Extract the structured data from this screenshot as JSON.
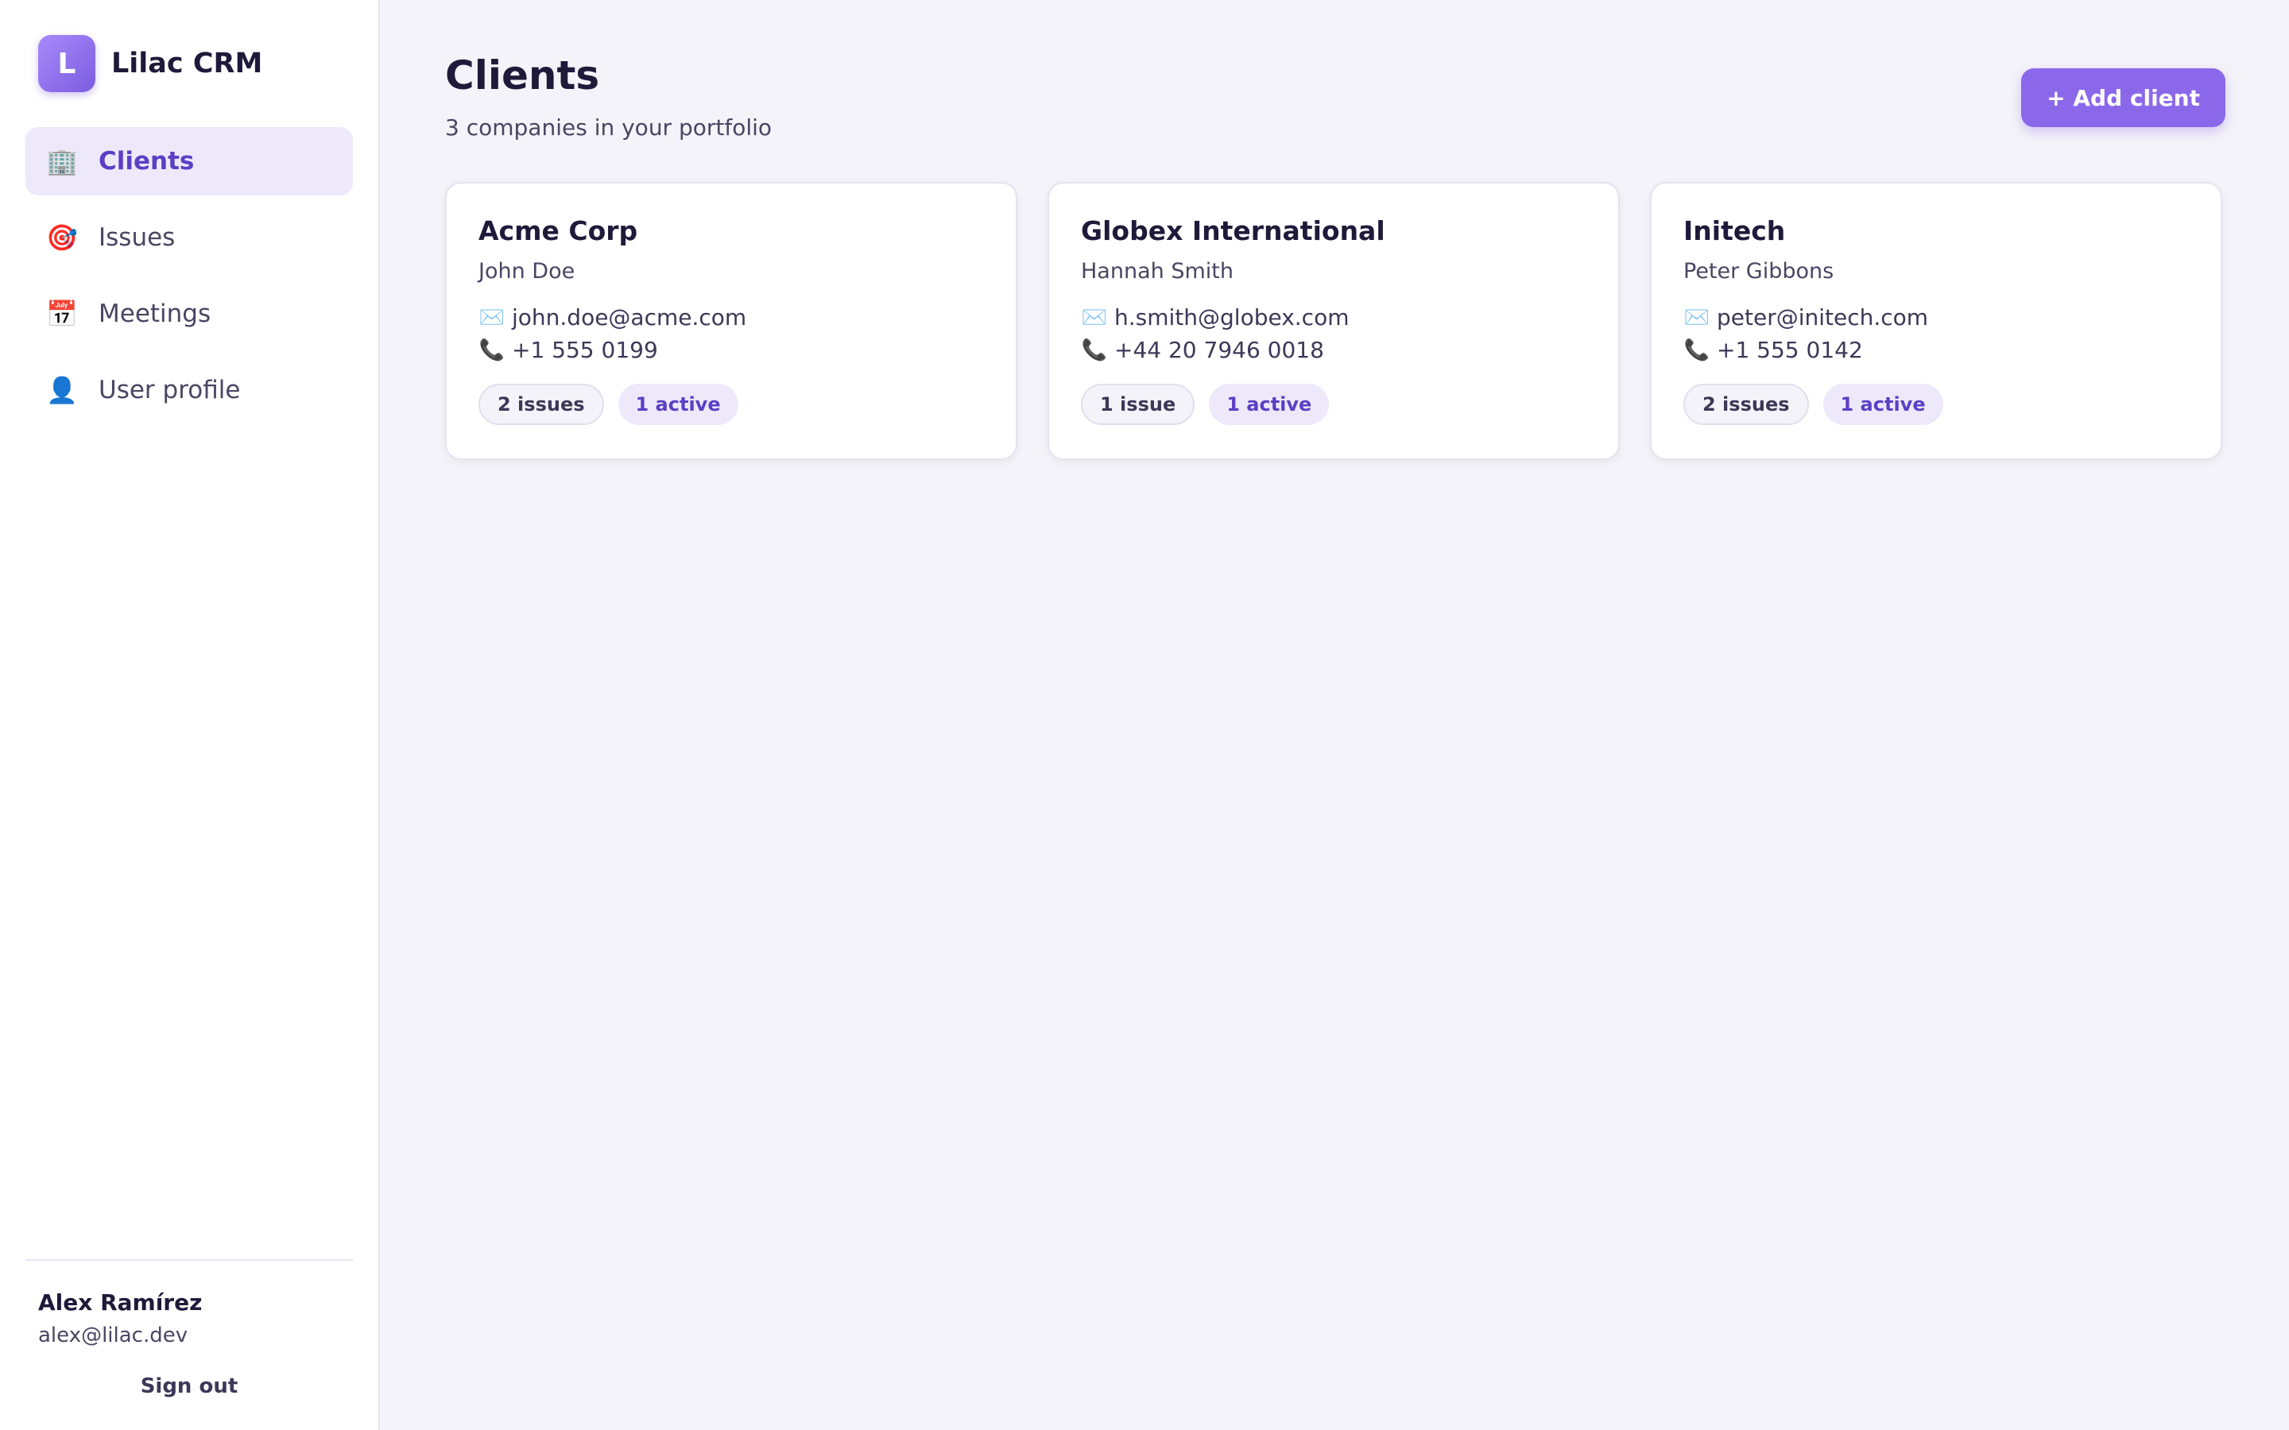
{
  "brand": {
    "logo_letter": "L",
    "name": "Lilac CRM"
  },
  "nav": [
    {
      "icon": "🏢",
      "icon_name": "building-icon",
      "label": "Clients",
      "active": true
    },
    {
      "icon": "🎯",
      "icon_name": "target-icon",
      "label": "Issues",
      "active": false
    },
    {
      "icon": "📅",
      "icon_name": "calendar-icon",
      "label": "Meetings",
      "active": false
    },
    {
      "icon": "👤",
      "icon_name": "user-icon",
      "label": "User profile",
      "active": false
    }
  ],
  "user": {
    "name": "Alex Ramírez",
    "email": "alex@lilac.dev",
    "signout_label": "Sign out"
  },
  "header": {
    "title": "Clients",
    "subtitle": "3 companies in your portfolio",
    "add_button_label": "+ Add client"
  },
  "icons": {
    "email": "✉️",
    "phone": "📞"
  },
  "clients": [
    {
      "company": "Acme Corp",
      "contact": "John Doe",
      "email": "john.doe@acme.com",
      "phone": "+1 555 0199",
      "issues_label": "2 issues",
      "active_label": "1 active"
    },
    {
      "company": "Globex International",
      "contact": "Hannah Smith",
      "email": "h.smith@globex.com",
      "phone": "+44 20 7946 0018",
      "issues_label": "1 issue",
      "active_label": "1 active"
    },
    {
      "company": "Initech",
      "contact": "Peter Gibbons",
      "email": "peter@initech.com",
      "phone": "+1 555 0142",
      "issues_label": "2 issues",
      "active_label": "1 active"
    }
  ],
  "colors": {
    "accent": "#8b68ea",
    "accent_text": "#5b3fc4",
    "accent_soft": "#ede9fb",
    "background": "#f4f3f9"
  }
}
